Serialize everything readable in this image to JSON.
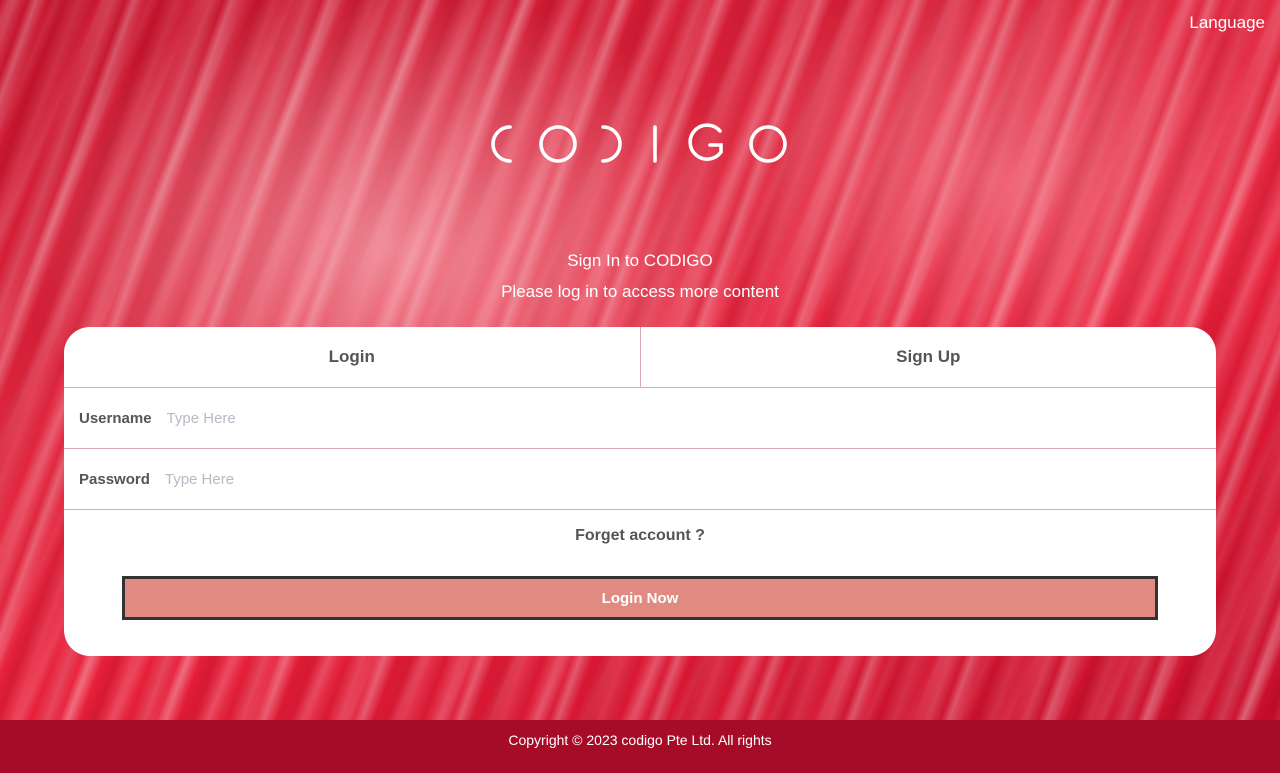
{
  "header": {
    "language_label": "Language",
    "logo_text": "CODIGO"
  },
  "intro": {
    "title": "Sign In to CODIGO",
    "subtitle": "Please log in to access more content"
  },
  "tabs": [
    {
      "label": "Login",
      "active": true
    },
    {
      "label": "Sign Up",
      "active": false
    }
  ],
  "form": {
    "username": {
      "label": "Username",
      "placeholder": "Type Here",
      "value": ""
    },
    "password": {
      "label": "Password",
      "placeholder": "Type Here",
      "value": ""
    },
    "forget_label": "Forget account ?",
    "submit_label": "Login Now"
  },
  "footer": {
    "copyright": "Copyright © 2023 codigo Pte Ltd. All rights"
  },
  "colors": {
    "brand_red": "#e0273f",
    "footer_bg": "#a60c27",
    "button_bg": "#e08a82",
    "divider": "#d9a9b3"
  }
}
